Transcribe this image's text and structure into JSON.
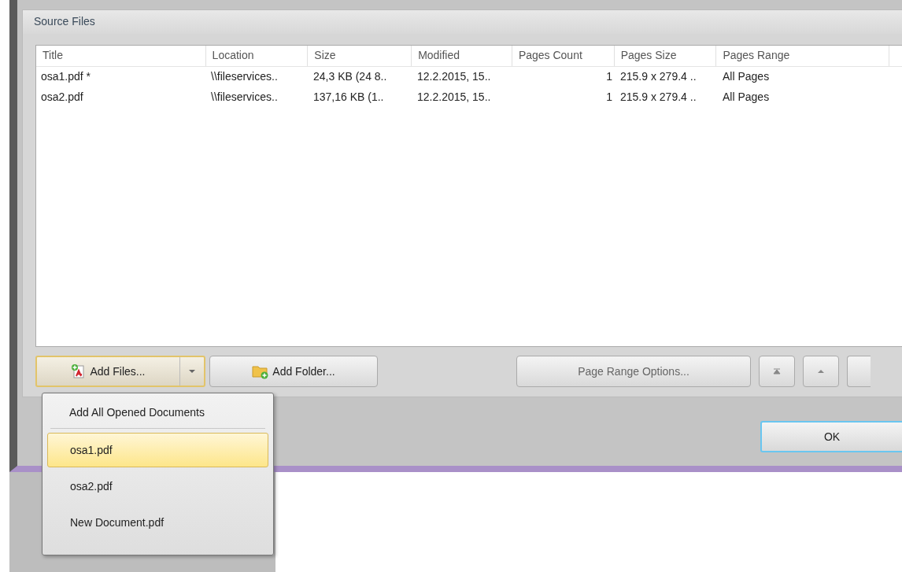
{
  "group_title": "Source Files",
  "table": {
    "columns": [
      "Title",
      "Location",
      "Size",
      "Modified",
      "Pages Count",
      "Pages Size",
      "Pages Range"
    ],
    "rows": [
      [
        "osa1.pdf *",
        "\\\\fileservices..",
        "24,3 KB (24 8..",
        "12.2.2015, 15..",
        "1",
        "215.9 x 279.4 ..",
        "All Pages"
      ],
      [
        "osa2.pdf",
        "\\\\fileservices..",
        "137,16 KB (1..",
        "12.2.2015, 15..",
        "1",
        "215.9 x 279.4 ..",
        "All Pages"
      ]
    ]
  },
  "add_files": {
    "label": "Add Files...",
    "pressed": true
  },
  "add_folder": {
    "label": "Add Folder..."
  },
  "page_range": {
    "label": "Page Range Options...",
    "disabled": true
  },
  "ok": {
    "label": "OK"
  },
  "menu": {
    "header": "Add All Opened Documents",
    "items": [
      {
        "label": "osa1.pdf",
        "selected": true
      },
      {
        "label": "osa2.pdf",
        "selected": false
      },
      {
        "label": "New Document.pdf",
        "selected": false
      }
    ]
  }
}
